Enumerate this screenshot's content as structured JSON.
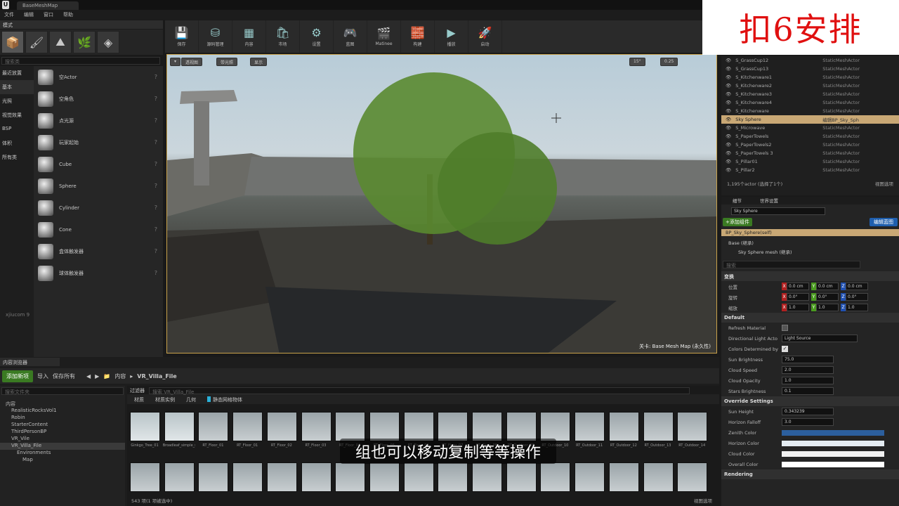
{
  "titlebar": {
    "logo": "U",
    "tab_title": "BaseMeshMap"
  },
  "menu": [
    "文件",
    "编辑",
    "窗口",
    "帮助"
  ],
  "modes": {
    "tab_label": "模式",
    "search_placeholder": "搜索类",
    "categories": [
      "最近放置",
      "基本",
      "光照",
      "视觉效果",
      "BSP",
      "体积",
      "所有类"
    ],
    "items": [
      "空Actor",
      "空角色",
      "点光源",
      "玩家起始",
      "Cube",
      "Sphere",
      "Cylinder",
      "Cone",
      "盒体触发器",
      "球体触发器"
    ],
    "watermark": "xjiucom 9"
  },
  "toolbar": [
    "保存",
    "源码管理",
    "内容",
    "市场",
    "设置",
    "蓝图",
    "Matinee",
    "构建",
    "播放",
    "启动"
  ],
  "viewport": {
    "btn_perspective": "透视图",
    "btn_lit": "带光照",
    "btn_show": "显示",
    "snap_angle": "15°",
    "snap_scale": "0.25",
    "level_label": "关卡: Base Mesh Map (永久性)"
  },
  "outliner": {
    "rows": [
      {
        "name": "S_GrassCup12",
        "type": "StaticMeshActor"
      },
      {
        "name": "S_GrassCup13",
        "type": "StaticMeshActor"
      },
      {
        "name": "S_Kitchenware1",
        "type": "StaticMeshActor"
      },
      {
        "name": "S_Kitchenware2",
        "type": "StaticMeshActor"
      },
      {
        "name": "S_Kitchenware3",
        "type": "StaticMeshActor"
      },
      {
        "name": "S_Kitchenware4",
        "type": "StaticMeshActor"
      },
      {
        "name": "S_Kitchenware",
        "type": "StaticMeshActor"
      },
      {
        "name": "Sky Sphere",
        "type": "编辑BP_Sky_Sph"
      },
      {
        "name": "S_Microwave",
        "type": "StaticMeshActor"
      },
      {
        "name": "S_PaperTowels",
        "type": "StaticMeshActor"
      },
      {
        "name": "S_PaperTowels2",
        "type": "StaticMeshActor"
      },
      {
        "name": "S_PaperTowels 3",
        "type": "StaticMeshActor"
      },
      {
        "name": "S_Pillar01",
        "type": "StaticMeshActor"
      },
      {
        "name": "S_Pillar2",
        "type": "StaticMeshActor"
      }
    ],
    "footer": "1,195个actor (选择了1个)",
    "view_options": "视图选项"
  },
  "details": {
    "tab1": "细节",
    "tab2": "世界设置",
    "name_value": "Sky Sphere",
    "add_component": "+添加组件",
    "edit_blueprint": "编辑蓝图",
    "component_root": "BP_Sky_Sphere(self)",
    "component_base": "Base (继承)",
    "component_mesh": "Sky Sphere mesh (继承)",
    "search_placeholder": "搜索",
    "transform_section": "变换",
    "location_label": "位置",
    "rotation_label": "旋转",
    "scale_label": "缩放",
    "location": [
      "0.0 cm",
      "0.0 cm",
      "0.0 cm"
    ],
    "rotation": [
      "0.0°",
      "0.0°",
      "0.0°"
    ],
    "scale": [
      "1.0",
      "1.0",
      "1.0"
    ],
    "default_section": "Default",
    "refresh_material": "Refresh Material",
    "dir_light_label": "Directional Light Acto",
    "dir_light_value": "Light Source",
    "colors_by_sun": "Colors Determined by",
    "sun_brightness_label": "Sun Brightness",
    "sun_brightness": "75.0",
    "cloud_speed_label": "Cloud Speed",
    "cloud_speed": "2.0",
    "cloud_opacity_label": "Cloud Opacity",
    "cloud_opacity": "1.0",
    "stars_label": "Stars Brightness",
    "stars": "0.1",
    "override_section": "Override Settings",
    "sun_height_label": "Sun Height",
    "sun_height": "0.343239",
    "horizon_falloff_label": "Horizon Falloff",
    "horizon_falloff": "3.0",
    "zenith_label": "Zenith Color",
    "horizon_color_label": "Horizon Color",
    "cloud_color_label": "Cloud Color",
    "overall_color_label": "Overall Color",
    "rendering_section": "Rendering",
    "colors": {
      "zenith": "#2c5f9e",
      "horizon": "#e4ecf2",
      "cloud": "#f0f0f0",
      "overall": "#ffffff"
    }
  },
  "content_browser": {
    "tab_label": "内容浏览器",
    "add_new": "添加新项",
    "import": "导入",
    "save_all": "保存所有",
    "path_root": "内容",
    "path_folder": "VR_Villa_File",
    "tree_search": "搜索文件夹",
    "tree": [
      "内容",
      "RealisticRocksVol1",
      "Robin",
      "StarterContent",
      "ThirdPersonBP",
      "VR_Vile",
      "VR_Villa_File",
      "Environments",
      "Map"
    ],
    "filters_label": "过滤器",
    "asset_search": "搜索 VR_Villa_File",
    "filter_chips": [
      "材质",
      "材质实例",
      "几何",
      "静态网格物体"
    ],
    "labels": [
      "Ginkgo_Tree_01",
      "Broadleaf_simple_small",
      "RT_Floor_01",
      "RT_Floor_01",
      "RT_Floor_02",
      "RT_Floor_03",
      "RT_Floor_04",
      "RT_Floor_05",
      "RT_Floor_06",
      "RT_Floor_07",
      "RT_Floor_08",
      "RT_Outdoor_09",
      "RT_Outdoor_10",
      "RT_Outdoor_11",
      "RT_Outdoor_12",
      "RT_Outdoor_13",
      "RT_Outdoor_14"
    ],
    "status": "543 项(1 项被选中)",
    "view_options": "视图选项"
  },
  "subtitle": "组也可以移动复制等等操作",
  "overlay_text": "扣6安排"
}
